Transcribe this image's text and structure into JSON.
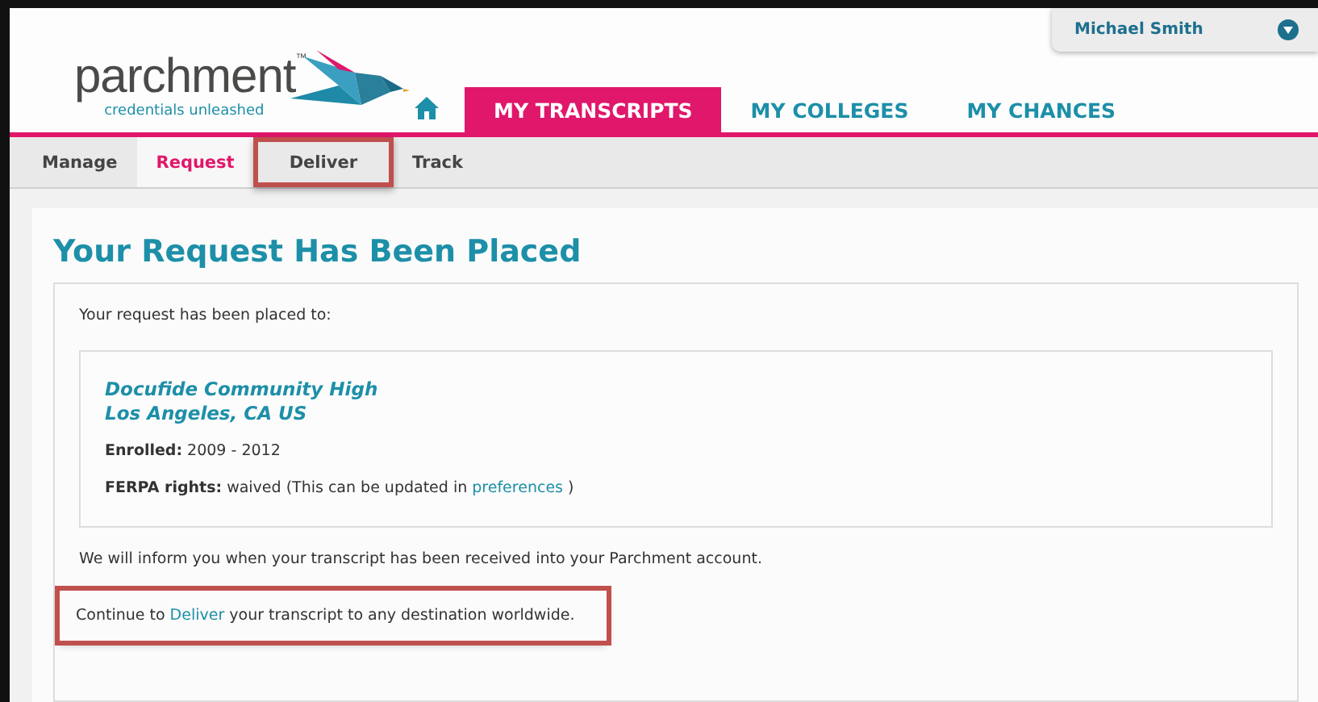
{
  "user_menu": {
    "name": "Michael Smith"
  },
  "logo": {
    "wordmark": "parchment",
    "trademark": "™",
    "tagline": "credentials unleashed"
  },
  "main_nav": [
    {
      "kind": "home",
      "selected": false
    },
    {
      "kind": "text",
      "label": "MY TRANSCRIPTS",
      "selected": true
    },
    {
      "kind": "text",
      "label": "MY COLLEGES",
      "selected": false
    },
    {
      "kind": "text",
      "label": "MY CHANCES",
      "selected": false
    }
  ],
  "sub_nav": [
    {
      "label": "Manage",
      "selected": false,
      "highlighted": false
    },
    {
      "label": "Request",
      "selected": true,
      "highlighted": false
    },
    {
      "label": "Deliver",
      "selected": false,
      "highlighted": true
    },
    {
      "label": "Track",
      "selected": false,
      "highlighted": false
    }
  ],
  "title": "Your Request Has Been Placed",
  "intro": "Your request has been placed to:",
  "school": {
    "name": "Docufide Community High",
    "location": "Los Angeles, CA US",
    "enrolled": "**Enrolled:** 2009 - 2012",
    "ferpa_before": "**FERPA rights:** waived (This can be updated in ",
    "ferpa_link": "preferences",
    "ferpa_after": " )"
  },
  "notice": "We will inform you when your transcript has been received into your Parchment account.",
  "continue": {
    "before": "Continue to ",
    "link": "Deliver",
    "after": " your transcript to any destination worldwide.",
    "highlighted": true
  }
}
